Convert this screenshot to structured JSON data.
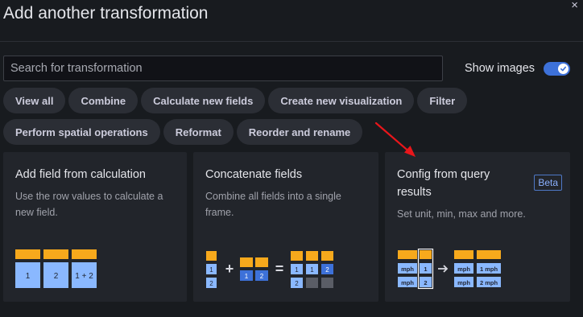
{
  "dialog": {
    "title": "Add another transformation",
    "close_glyph": "×"
  },
  "search": {
    "placeholder": "Search for transformation",
    "value": ""
  },
  "show_images": {
    "label": "Show images",
    "on": true
  },
  "filters": {
    "row1": [
      "View all",
      "Combine",
      "Calculate new fields",
      "Create new visualization",
      "Filter"
    ],
    "row2": [
      "Perform spatial operations",
      "Reformat",
      "Reorder and rename"
    ]
  },
  "cards": [
    {
      "title": "Add field from calculation",
      "desc_lines": [
        "Use the row values to calculate a",
        "new field."
      ],
      "preview_labels": [
        "1",
        "2",
        "1 + 2"
      ]
    },
    {
      "title": "Concatenate fields",
      "desc_lines": [
        "Combine all fields into a single",
        "frame."
      ],
      "preview_labels": [
        "1",
        "2",
        "1",
        "2",
        "1",
        "1",
        "2",
        "2"
      ]
    },
    {
      "title_lines": [
        "Config from query",
        "results"
      ],
      "badge": "Beta",
      "desc_lines": [
        "Set unit, min, max and more."
      ],
      "preview_labels": [
        "mph",
        "1",
        "mph",
        "2",
        "mph",
        "1 mph",
        "mph",
        "2 mph"
      ]
    }
  ],
  "colors": {
    "accent": "#3d71d9",
    "arrow": "#e8161b",
    "header_bar": "#f7a91c",
    "cell": "#8ab8ff",
    "cell_dark": "#3d71d9"
  }
}
